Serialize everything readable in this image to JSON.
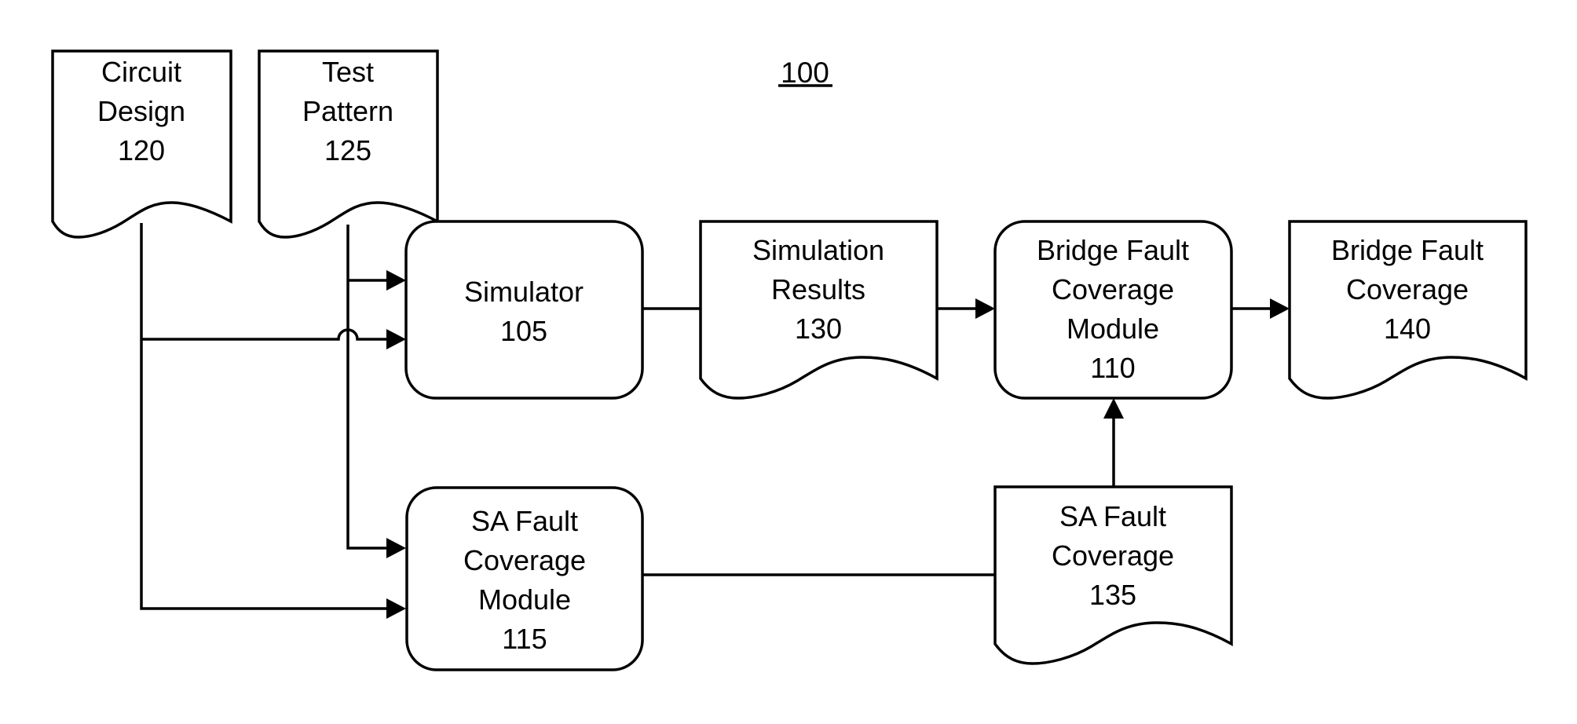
{
  "figure": {
    "number": "100"
  },
  "nodes": {
    "circuit_design": {
      "type": "document",
      "lines": [
        "Circuit",
        "Design",
        "120"
      ]
    },
    "test_pattern": {
      "type": "document",
      "lines": [
        "Test",
        "Pattern",
        "125"
      ]
    },
    "simulator": {
      "type": "process",
      "lines": [
        "Simulator",
        "105"
      ]
    },
    "simulation_results": {
      "type": "document",
      "lines": [
        "Simulation",
        "Results",
        "130"
      ]
    },
    "bridge_module": {
      "type": "process",
      "lines": [
        "Bridge Fault",
        "Coverage",
        "Module",
        "110"
      ]
    },
    "bridge_coverage": {
      "type": "document",
      "lines": [
        "Bridge Fault",
        "Coverage",
        "140"
      ]
    },
    "sa_module": {
      "type": "process",
      "lines": [
        "SA Fault",
        "Coverage",
        "Module",
        "115"
      ]
    },
    "sa_coverage": {
      "type": "document",
      "lines": [
        "SA Fault",
        "Coverage",
        "135"
      ]
    }
  },
  "edges": [
    {
      "from": "test_pattern",
      "to": "simulator",
      "arrow": true
    },
    {
      "from": "circuit_design",
      "to": "simulator",
      "arrow": true,
      "crossing_hop": true
    },
    {
      "from": "test_pattern",
      "to": "sa_module",
      "arrow": true
    },
    {
      "from": "circuit_design",
      "to": "sa_module",
      "arrow": true
    },
    {
      "from": "simulator",
      "to": "simulation_results",
      "arrow": false
    },
    {
      "from": "simulation_results",
      "to": "bridge_module",
      "arrow": true
    },
    {
      "from": "bridge_module",
      "to": "bridge_coverage",
      "arrow": true
    },
    {
      "from": "sa_module",
      "to": "sa_coverage",
      "arrow": false
    },
    {
      "from": "sa_coverage",
      "to": "bridge_module",
      "arrow": true
    }
  ]
}
